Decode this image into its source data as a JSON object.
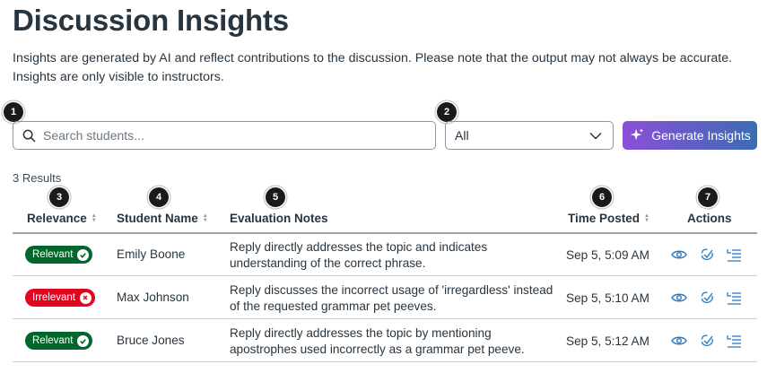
{
  "page": {
    "title": "Discussion Insights",
    "description": "Insights are generated by AI and reflect contributions to the discussion. Please note that the output may not always be accurate. Insights are only visible to instructors."
  },
  "callouts": [
    "1",
    "2",
    "3",
    "4",
    "5",
    "6",
    "7"
  ],
  "search": {
    "placeholder": "Search students...",
    "value": ""
  },
  "filter": {
    "selected": "All"
  },
  "generate_button": {
    "label": "Generate Insights"
  },
  "results_count": "3 Results",
  "table": {
    "columns": [
      "Relevance",
      "Student Name",
      "Evaluation Notes",
      "Time Posted",
      "Actions"
    ],
    "rows": [
      {
        "relevance": "Relevant",
        "status": "relevant",
        "student": "Emily Boone",
        "notes_line1": "Reply directly addresses the topic and indicates",
        "notes_line2": "understanding of the correct phrase.",
        "time": "Sep 5, 5:09 AM"
      },
      {
        "relevance": "Irrelevant",
        "status": "irrelevant",
        "student": "Max Johnson",
        "notes_line1": "Reply discusses the incorrect usage of 'irregardless' instead",
        "notes_line2": "of the requested grammar pet peeves.",
        "time": "Sep 5, 5:10 AM"
      },
      {
        "relevance": "Relevant",
        "status": "relevant",
        "student": "Bruce Jones",
        "notes_line1": "Reply directly addresses the topic by mentioning",
        "notes_line2": "apostrophes used incorrectly as a grammar pet peeve.",
        "time": "Sep 5, 5:12 AM"
      }
    ]
  },
  "colors": {
    "relevant": "#02672d",
    "irrelevant": "#e0061f",
    "icon": "#2b7abc",
    "text": "#273540"
  },
  "icons": [
    "search-icon",
    "chevron-down-icon",
    "sparkle-icon",
    "check-icon",
    "x-icon",
    "eye-icon",
    "review-check-icon",
    "list-details-icon"
  ]
}
